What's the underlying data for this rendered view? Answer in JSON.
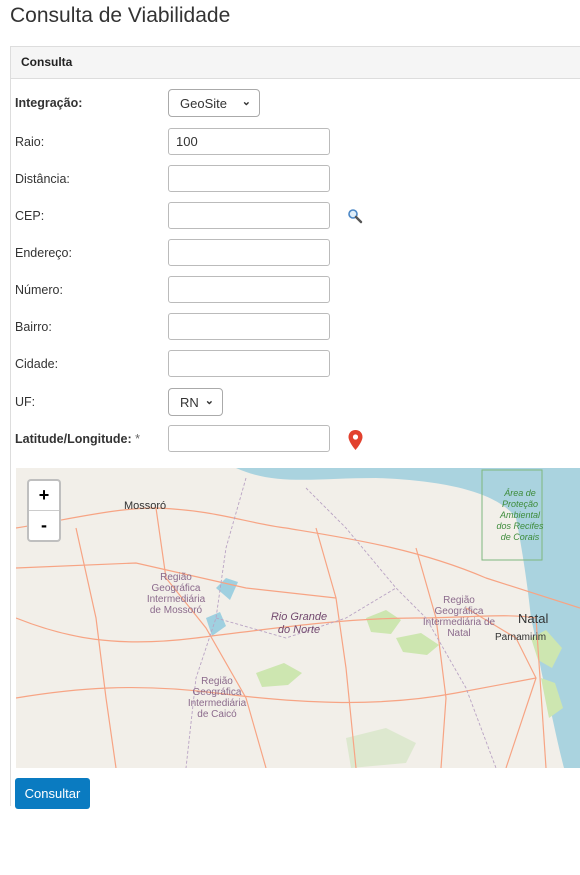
{
  "page_title": "Consulta de Viabilidade",
  "panel_title": "Consulta",
  "fields": {
    "integracao": {
      "label": "Integração:",
      "value": "GeoSite"
    },
    "raio": {
      "label": "Raio:",
      "value": "100"
    },
    "distancia": {
      "label": "Distância:",
      "value": ""
    },
    "cep": {
      "label": "CEP:",
      "value": ""
    },
    "endereco": {
      "label": "Endereço:",
      "value": ""
    },
    "numero": {
      "label": "Número:",
      "value": ""
    },
    "bairro": {
      "label": "Bairro:",
      "value": ""
    },
    "cidade": {
      "label": "Cidade:",
      "value": ""
    },
    "uf": {
      "label": "UF:",
      "value": "RN"
    },
    "latlng": {
      "label": "Latitude/Longitude:",
      "required_mark": "*",
      "value": ""
    }
  },
  "map": {
    "zoom_in": "+",
    "zoom_out": "-",
    "labels": {
      "mossoro": "Mossoró",
      "natal": "Natal",
      "parnamirim": "Parnamirim",
      "rgn": "Rio Grande do Norte",
      "reg_mossoro": "Região Geográfica Intermediária de Mossoró",
      "reg_natal": "Região Geográfica Intermediária de Natal",
      "reg_caico": "Região Geográfica Intermediária de Caicó",
      "area_protecao": "Área de Proteção Ambiental dos Recifes de Corais"
    },
    "colors": {
      "land": "#f2efe9",
      "sea": "#aad3df",
      "green": "#cde6b0",
      "roads": "#f7a484",
      "borders": "#b9a3c4"
    }
  },
  "submit_label": "Consultar",
  "icons": {
    "cep_search": "magnifier-icon",
    "location": "map-pin-icon"
  }
}
